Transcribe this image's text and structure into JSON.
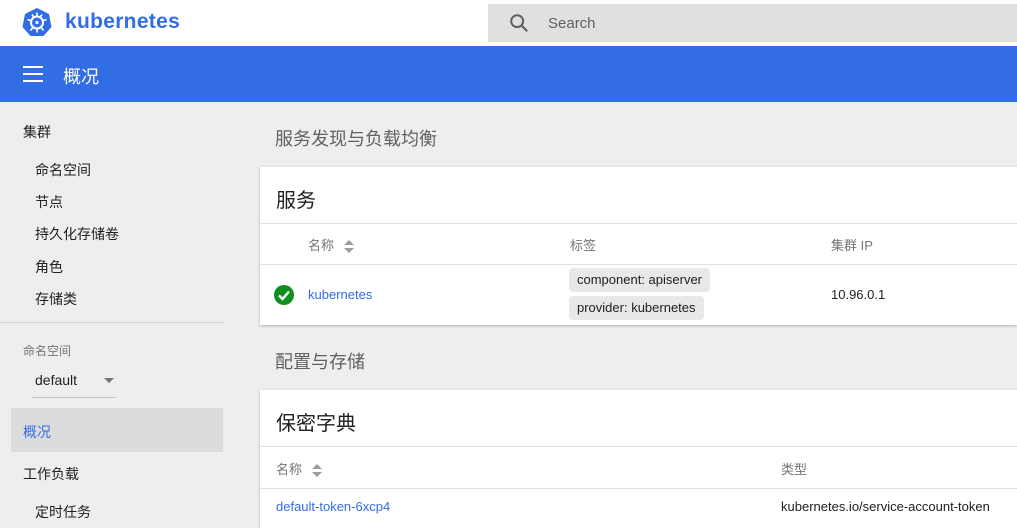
{
  "topbar": {
    "brand": "kubernetes",
    "search_placeholder": "Search"
  },
  "titlebar": {
    "title": "概况"
  },
  "sidebar": {
    "cluster_section": "集群",
    "cluster_items": [
      "命名空间",
      "节点",
      "持久化存储卷",
      "角色",
      "存储类"
    ],
    "namespace_label": "命名空间",
    "namespace_value": "default",
    "overview_item": "概况",
    "workloads_section": "工作负载",
    "workloads_items": [
      "定时任务"
    ]
  },
  "main": {
    "discovery_header": "服务发现与负载均衡",
    "services_card": {
      "title": "服务",
      "columns": [
        "名称",
        "标签",
        "集群 IP"
      ],
      "rows": [
        {
          "name": "kubernetes",
          "labels": [
            "component: apiserver",
            "provider: kubernetes"
          ],
          "cluster_ip": "10.96.0.1",
          "status": "running"
        }
      ]
    },
    "config_header": "配置与存储",
    "secrets_card": {
      "title": "保密字典",
      "columns": [
        "名称",
        "类型"
      ],
      "rows": [
        {
          "name": "default-token-6xcp4",
          "type": "kubernetes.io/service-account-token"
        }
      ]
    }
  },
  "colors": {
    "brand_blue": "#326de6",
    "status_green": "#00a651"
  }
}
